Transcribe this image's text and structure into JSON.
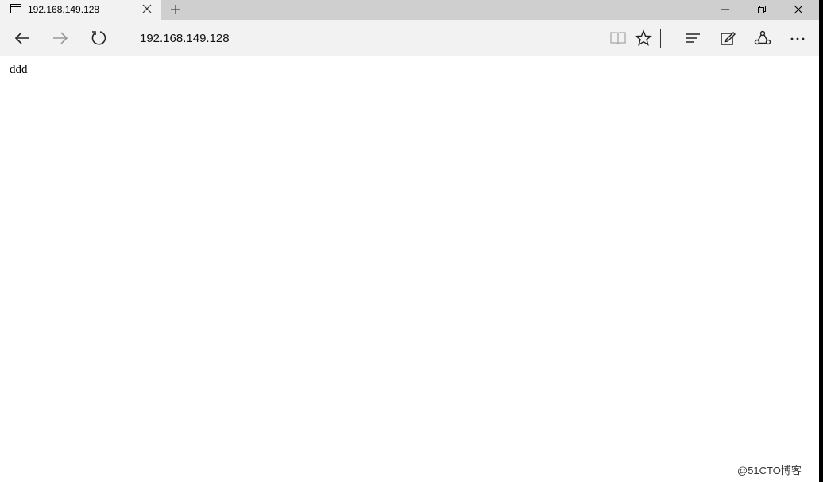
{
  "tab": {
    "title": "192.168.149.128"
  },
  "address_bar": {
    "url": "192.168.149.128"
  },
  "page": {
    "body_text": "ddd"
  },
  "watermark": {
    "text": "@51CTO博客"
  },
  "icons": {
    "tab": "page-icon",
    "close_tab": "close-icon",
    "new_tab": "plus-icon",
    "minimize": "minimize-icon",
    "maximize": "restore-icon",
    "close_window": "close-icon",
    "back": "arrow-left-icon",
    "forward": "arrow-right-icon",
    "refresh": "refresh-icon",
    "reading_view": "book-icon",
    "favorite": "star-icon",
    "hub": "hub-icon",
    "web_note": "pen-icon",
    "share": "share-icon",
    "more": "more-icon"
  },
  "colors": {
    "tabbar": "#cfcfcf",
    "toolbar": "#f2f2f2",
    "forward_disabled": "#9a9a9a"
  }
}
